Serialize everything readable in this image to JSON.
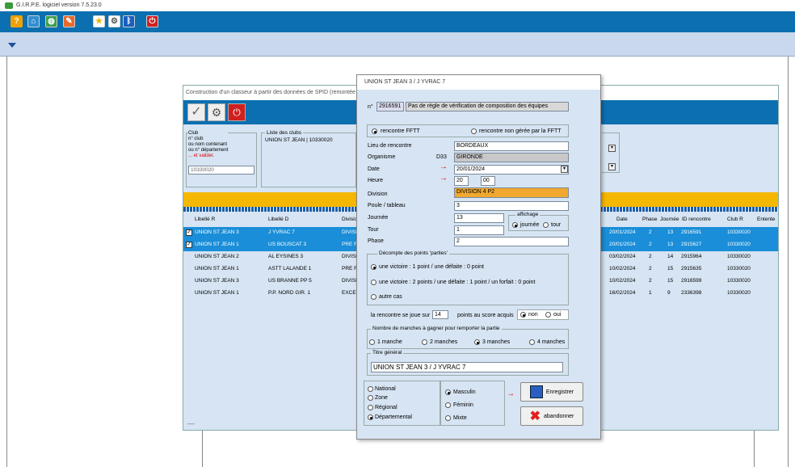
{
  "app": {
    "title": "G.I.R.P.E. logiciel version 7.5.23.0"
  },
  "toolbar": {
    "icons": [
      "help-icon",
      "home-icon",
      "globe-icon",
      "edit-icon",
      "star-icon",
      "settings-icon",
      "bluetooth-icon",
      "power-icon"
    ],
    "help_glyph": "?"
  },
  "background_window": {
    "title": "Construction d'un classeur à partir des données de SPID (remontée",
    "club_labels": [
      "Club",
      "n° club",
      "ou nom contenant",
      "ou n° département",
      "... et valider."
    ],
    "club_value": "10330020",
    "list_label": "Liste des clubs",
    "list_value": "UNION ST JEAN | 10330020",
    "columns_left": [
      "Libellé R",
      "Libellé D",
      "Divisio"
    ],
    "columns_right": [
      "Date",
      "Phase",
      "Journée",
      "ID rencontre",
      "Club R",
      "Entente"
    ],
    "rows": [
      {
        "checked": true,
        "selected": true,
        "r": "UNION ST JEAN 3",
        "d": "J YVRAC 7",
        "div": "DIVISI",
        "date": "20/01/2024",
        "phase": "2",
        "journee": "13",
        "id": "2916591",
        "club": "10330020"
      },
      {
        "checked": true,
        "selected": true,
        "r": "UNION ST JEAN 1",
        "d": "US BOUSCAT 3",
        "div": "PRE R",
        "date": "20/01/2024",
        "phase": "2",
        "journee": "13",
        "id": "2915627",
        "club": "10330020"
      },
      {
        "checked": false,
        "selected": false,
        "r": "UNION ST JEAN 2",
        "d": "AL EYSINES 3",
        "div": "DIVISI",
        "date": "03/02/2024",
        "phase": "2",
        "journee": "14",
        "id": "2915964",
        "club": "10330020"
      },
      {
        "checked": false,
        "selected": false,
        "r": "UNION ST JEAN 1",
        "d": "ASTT LALANDE 1",
        "div": "PRE R",
        "date": "10/02/2024",
        "phase": "2",
        "journee": "15",
        "id": "2915635",
        "club": "10330020"
      },
      {
        "checked": false,
        "selected": false,
        "r": "UNION ST JEAN 3",
        "d": "US BRANNE PP 5",
        "div": "DIVISI",
        "date": "10/02/2024",
        "phase": "2",
        "journee": "15",
        "id": "2916599",
        "club": "10330020"
      },
      {
        "checked": false,
        "selected": false,
        "r": "UNION ST JEAN 1",
        "d": "P.P. NORD GIR. 1",
        "div": "EXCEL",
        "date": "16/02/2024",
        "phase": "1",
        "journee": "9",
        "id": "2336398",
        "club": "10330020"
      }
    ],
    "bottom_mark": "—"
  },
  "dialog": {
    "title": "UNION ST JEAN 3  /  J YVRAC 7",
    "num_label": "n°",
    "num_value": "2916591",
    "rule_text": "Pas de règle de vérification de composition des équipes",
    "type_options": [
      "rencontre FFTT",
      "rencontre non gérée par la FFTT"
    ],
    "fields": {
      "lieu_label": "Lieu de rencontre",
      "lieu": "BORDEAUX",
      "organisme_label": "Organisme",
      "organisme_code": "D33",
      "organisme": "GIRONDE",
      "date_label": "Date",
      "date": "20/01/2024",
      "heure_label": "Heure",
      "heure_h": "20",
      "heure_m": "00",
      "division_label": "Division",
      "division": "DIVISION 4 P2",
      "poule_label": "Poule / tableau",
      "poule": "3",
      "journee_label": "Journée",
      "journee": "13",
      "tour_label": "Tour",
      "tour": "1",
      "phase_label": "Phase",
      "phase": "2"
    },
    "affichage_label": "affichage",
    "affichage_options": [
      "journée",
      "tour"
    ],
    "decompte_label": "Décompte des points 'parties'",
    "decompte_options": [
      "une victoire : 1 point / une défaite : 0 point",
      "une victoire : 2 points / une défaite : 1 point / un forfait : 0 point",
      "autre cas"
    ],
    "joue_sur_label": "la rencontre se joue sur",
    "joue_sur_value": "14",
    "points_acquis_label": "points au score acquis",
    "acquis_options": [
      "non",
      "oui"
    ],
    "manches_label": "Nombre de manches à gagner pour remporter la partie",
    "manches_options": [
      "1 manche",
      "2 manches",
      "3 manches",
      "4 manches"
    ],
    "titre_label": "Titre général",
    "titre_value": "UNION ST JEAN 3  /  J YVRAC 7",
    "niveau_options": [
      "National",
      "Zone",
      "Régional",
      "Départemental"
    ],
    "genre_options": [
      "Masculin",
      "Féminin",
      "Mixte"
    ],
    "save_label": "Enregistrer",
    "cancel_label": "abandonner"
  },
  "colors": {
    "toolbar_blue": "#0b6fb0",
    "selection_blue": "#1a8ed8",
    "yellow": "#f5b700",
    "division_orange": "#f0a830",
    "arrow_red": "#e00000"
  }
}
